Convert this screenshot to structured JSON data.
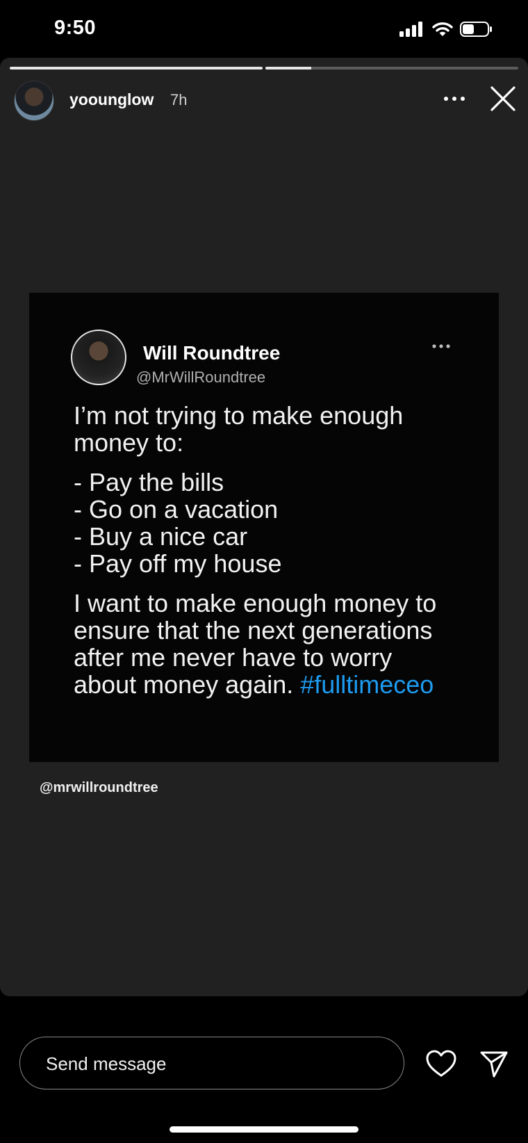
{
  "status_bar": {
    "time": "9:50",
    "icons": [
      "signal-icon",
      "wifi-icon",
      "battery-icon"
    ]
  },
  "story": {
    "progress": [
      1.0,
      0.18
    ],
    "user": {
      "username": "yoounglow",
      "time_ago": "7h"
    },
    "icons": {
      "more": "more-icon",
      "close": "close-icon"
    },
    "mention": "@mrwillroundtree"
  },
  "tweet": {
    "name": "Will Roundtree",
    "handle": "@MrWillRoundtree",
    "paragraph1": [
      "I’m not trying to make enough",
      "money to:"
    ],
    "list": [
      "- Pay the bills",
      "- Go on a vacation",
      "- Buy a nice car",
      "- Pay off my house"
    ],
    "paragraph2": [
      "I want to make enough money to",
      "ensure that the next generations",
      "after me never have to worry",
      "about money again. "
    ],
    "hashtag": "#fulltimeceo",
    "hashtag_color": "#1d9bf0"
  },
  "footer": {
    "message_placeholder": "Send message",
    "icons": {
      "like": "heart-icon",
      "share": "send-icon"
    }
  }
}
